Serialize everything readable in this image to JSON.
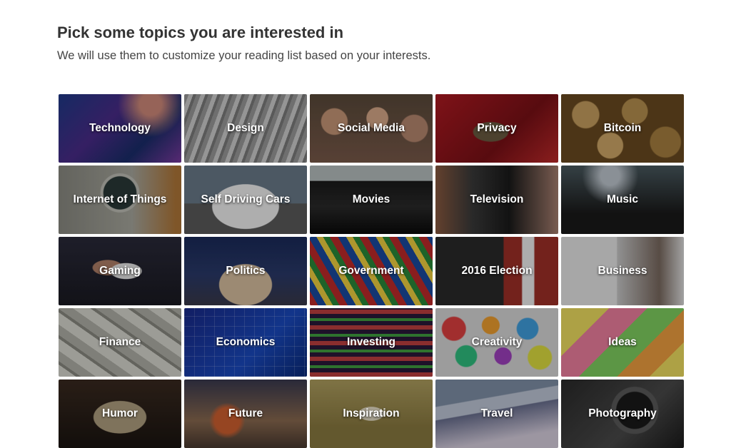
{
  "header": {
    "title": "Pick some topics you are interested in",
    "subtitle": "We will use them to customize your reading list based on your interests."
  },
  "topics": [
    {
      "label": "Technology"
    },
    {
      "label": "Design"
    },
    {
      "label": "Social Media"
    },
    {
      "label": "Privacy"
    },
    {
      "label": "Bitcoin"
    },
    {
      "label": "Internet of Things"
    },
    {
      "label": "Self Driving Cars"
    },
    {
      "label": "Movies"
    },
    {
      "label": "Television"
    },
    {
      "label": "Music"
    },
    {
      "label": "Gaming"
    },
    {
      "label": "Politics"
    },
    {
      "label": "Government"
    },
    {
      "label": "2016 Election"
    },
    {
      "label": "Business"
    },
    {
      "label": "Finance"
    },
    {
      "label": "Economics"
    },
    {
      "label": "Investing"
    },
    {
      "label": "Creativity"
    },
    {
      "label": "Ideas"
    },
    {
      "label": "Humor"
    },
    {
      "label": "Future"
    },
    {
      "label": "Inspiration"
    },
    {
      "label": "Travel"
    },
    {
      "label": "Photography"
    }
  ]
}
